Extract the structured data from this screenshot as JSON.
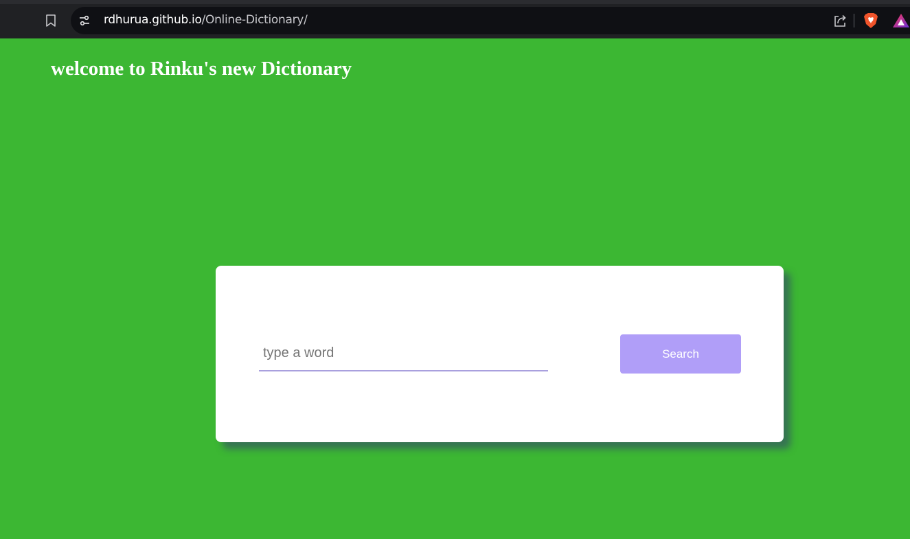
{
  "browser": {
    "url_host": "rdhurua.github.io",
    "url_path": "/Online-Dictionary/"
  },
  "page": {
    "heading": "welcome to Rinku's new Dictionary"
  },
  "search": {
    "placeholder": "type a word",
    "value": "",
    "button_label": "Search"
  },
  "colors": {
    "page_background": "#3cb733",
    "card_background": "#ffffff",
    "button_background": "#b09ef8",
    "input_underline": "#a9a0de"
  },
  "icons": [
    "bookmark-icon",
    "site-settings-icon",
    "share-icon",
    "brave-shields-icon",
    "brave-rewards-icon"
  ]
}
